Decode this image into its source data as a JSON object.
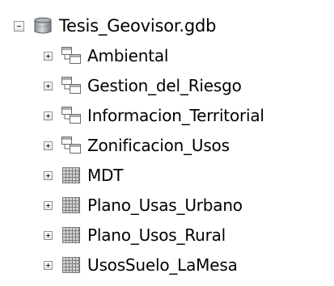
{
  "tree": {
    "root": {
      "label": "Tesis_Geovisor.gdb",
      "icon": "geodatabase-icon",
      "expanded": true
    },
    "children": [
      {
        "label": "Ambiental",
        "icon": "feature-dataset-icon"
      },
      {
        "label": "Gestion_del_Riesgo",
        "icon": "feature-dataset-icon"
      },
      {
        "label": "Informacion_Territorial",
        "icon": "feature-dataset-icon"
      },
      {
        "label": "Zonificacion_Usos",
        "icon": "feature-dataset-icon"
      },
      {
        "label": "MDT",
        "icon": "raster-dataset-icon"
      },
      {
        "label": "Plano_Usas_Urbano",
        "icon": "raster-dataset-icon"
      },
      {
        "label": "Plano_Usos_Rural",
        "icon": "raster-dataset-icon"
      },
      {
        "label": "UsosSuelo_LaMesa",
        "icon": "raster-dataset-icon"
      }
    ]
  }
}
